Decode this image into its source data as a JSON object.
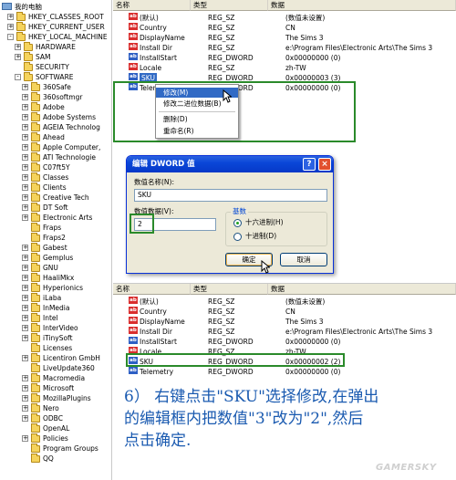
{
  "tree": {
    "root": "我的电脑",
    "nodes": [
      {
        "label": "HKEY_CLASSES_ROOT",
        "level": 1,
        "expander": "+"
      },
      {
        "label": "HKEY_CURRENT_USER",
        "level": 1,
        "expander": "+"
      },
      {
        "label": "HKEY_LOCAL_MACHINE",
        "level": 1,
        "expander": "-"
      },
      {
        "label": "HARDWARE",
        "level": 2,
        "expander": "+"
      },
      {
        "label": "SAM",
        "level": 2,
        "expander": "+"
      },
      {
        "label": "SECURITY",
        "level": 2,
        "expander": ""
      },
      {
        "label": "SOFTWARE",
        "level": 2,
        "expander": "-"
      },
      {
        "label": "360Safe",
        "level": 3,
        "expander": "+"
      },
      {
        "label": "360softmgr",
        "level": 3,
        "expander": "+"
      },
      {
        "label": "Adobe",
        "level": 3,
        "expander": "+"
      },
      {
        "label": "Adobe Systems",
        "level": 3,
        "expander": "+"
      },
      {
        "label": "AGEIA Technolog",
        "level": 3,
        "expander": "+"
      },
      {
        "label": "Ahead",
        "level": 3,
        "expander": "+"
      },
      {
        "label": "Apple Computer,",
        "level": 3,
        "expander": "+"
      },
      {
        "label": "ATI Technologie",
        "level": 3,
        "expander": "+"
      },
      {
        "label": "C07ft5Y",
        "level": 3,
        "expander": "+"
      },
      {
        "label": "Classes",
        "level": 3,
        "expander": "+"
      },
      {
        "label": "Clients",
        "level": 3,
        "expander": "+"
      },
      {
        "label": "Creative Tech",
        "level": 3,
        "expander": "+"
      },
      {
        "label": "DT Soft",
        "level": 3,
        "expander": "+"
      },
      {
        "label": "Electronic Arts",
        "level": 3,
        "expander": "+"
      },
      {
        "label": "Fraps",
        "level": 3,
        "expander": ""
      },
      {
        "label": "Fraps2",
        "level": 3,
        "expander": ""
      },
      {
        "label": "Gabest",
        "level": 3,
        "expander": "+"
      },
      {
        "label": "Gemplus",
        "level": 3,
        "expander": "+"
      },
      {
        "label": "GNU",
        "level": 3,
        "expander": "+"
      },
      {
        "label": "HaaliMkx",
        "level": 3,
        "expander": "+"
      },
      {
        "label": "Hyperionics",
        "level": 3,
        "expander": "+"
      },
      {
        "label": "iLaba",
        "level": 3,
        "expander": "+"
      },
      {
        "label": "InMedia",
        "level": 3,
        "expander": "+"
      },
      {
        "label": "Intel",
        "level": 3,
        "expander": "+"
      },
      {
        "label": "InterVideo",
        "level": 3,
        "expander": "+"
      },
      {
        "label": "iTinySoft",
        "level": 3,
        "expander": "+"
      },
      {
        "label": "Licenses",
        "level": 3,
        "expander": ""
      },
      {
        "label": "Licentiron GmbH",
        "level": 3,
        "expander": "+"
      },
      {
        "label": "LiveUpdate360",
        "level": 3,
        "expander": ""
      },
      {
        "label": "Macromedia",
        "level": 3,
        "expander": "+"
      },
      {
        "label": "Microsoft",
        "level": 3,
        "expander": "+"
      },
      {
        "label": "MozillaPlugins",
        "level": 3,
        "expander": "+"
      },
      {
        "label": "Nero",
        "level": 3,
        "expander": "+"
      },
      {
        "label": "ODBC",
        "level": 3,
        "expander": "+"
      },
      {
        "label": "OpenAL",
        "level": 3,
        "expander": ""
      },
      {
        "label": "Policies",
        "level": 3,
        "expander": "+"
      },
      {
        "label": "Program Groups",
        "level": 3,
        "expander": ""
      },
      {
        "label": "QQ",
        "level": 3,
        "expander": ""
      }
    ]
  },
  "columns": {
    "name": "名称",
    "type": "类型",
    "data": "数据"
  },
  "top_list": [
    {
      "icon": "ab",
      "name": "(默认)",
      "type": "REG_SZ",
      "data": "(数值未设置)"
    },
    {
      "icon": "ab",
      "name": "Country",
      "type": "REG_SZ",
      "data": "CN"
    },
    {
      "icon": "ab",
      "name": "DisplayName",
      "type": "REG_SZ",
      "data": "The Sims 3"
    },
    {
      "icon": "ab",
      "name": "Install Dir",
      "type": "REG_SZ",
      "data": "e:\\Program Files\\Electronic Arts\\The Sims 3"
    },
    {
      "icon": "dw",
      "name": "InstallStart",
      "type": "REG_DWORD",
      "data": "0x00000000 (0)"
    },
    {
      "icon": "ab",
      "name": "Locale",
      "type": "REG_SZ",
      "data": "zh-TW"
    },
    {
      "icon": "dw",
      "name": "SKU",
      "type": "REG_DWORD",
      "data": "0x00000003 (3)",
      "selected": true
    },
    {
      "icon": "dw",
      "name": "Telemetry",
      "type": "REG_DWORD",
      "data": "0x00000000 (0)"
    }
  ],
  "context_menu": {
    "items": [
      "修改(M)",
      "修改二进位数据(B)",
      "删除(D)",
      "重命名(R)"
    ]
  },
  "dialog": {
    "title": "编辑 DWORD 值",
    "help_glyph": "?",
    "close_glyph": "×",
    "name_label": "数值名称(N):",
    "name_value": "SKU",
    "data_label": "数值数据(V):",
    "data_value": "2",
    "base_label": "基数",
    "hex_label": "十六进制(H)",
    "dec_label": "十进制(D)",
    "hex_selected": true,
    "ok": "确定",
    "cancel": "取消"
  },
  "bottom_list": [
    {
      "icon": "ab",
      "name": "(默认)",
      "type": "REG_SZ",
      "data": "(数值未设置)"
    },
    {
      "icon": "ab",
      "name": "Country",
      "type": "REG_SZ",
      "data": "CN"
    },
    {
      "icon": "ab",
      "name": "DisplayName",
      "type": "REG_SZ",
      "data": "The Sims 3"
    },
    {
      "icon": "ab",
      "name": "Install Dir",
      "type": "REG_SZ",
      "data": "e:\\Program Files\\Electronic Arts\\The Sims 3"
    },
    {
      "icon": "dw",
      "name": "InstallStart",
      "type": "REG_DWORD",
      "data": "0x00000000 (0)"
    },
    {
      "icon": "ab",
      "name": "Locale",
      "type": "REG_SZ",
      "data": "zh-TW"
    },
    {
      "icon": "dw",
      "name": "SKU",
      "type": "REG_DWORD",
      "data": "0x00000002 (2)"
    },
    {
      "icon": "dw",
      "name": "Telemetry",
      "type": "REG_DWORD",
      "data": "0x00000000 (0)"
    }
  ],
  "caption": [
    "6） 右键点击\"SKU\"选择修改,在弹出",
    "的编辑框内把数值\"3\"改为\"2\",然后",
    "点击确定."
  ],
  "watermark": "GAMERSKY",
  "icon_text": {
    "ab": "ab",
    "dw": "ab"
  },
  "colors": {
    "accent_green": "#2a8a2a",
    "caption_blue": "#1a5ab0",
    "selection": "#316ac5"
  }
}
